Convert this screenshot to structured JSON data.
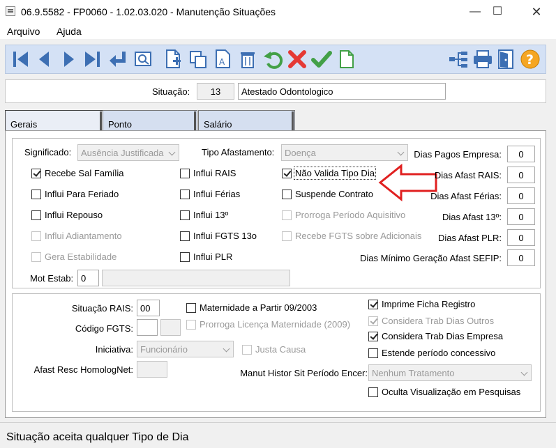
{
  "window": {
    "title": "06.9.5582 - FP0060 - 1.02.03.020 - Manutenção Situações",
    "minimize": "—",
    "maximize": "☐",
    "close": "✕"
  },
  "menu": {
    "items": [
      "Arquivo",
      "Ajuda"
    ]
  },
  "toolbar": {
    "icons": [
      "first-icon",
      "previous-icon",
      "next-icon",
      "last-icon",
      "return-icon",
      "zoom-icon",
      "new-icon",
      "copy-icon",
      "text-icon",
      "delete-icon",
      "undo-icon",
      "cancel-icon",
      "confirm-icon",
      "blank-page-icon",
      "tree-icon",
      "print-icon",
      "exit-icon",
      "help-icon"
    ],
    "help_glyph": "?"
  },
  "situacao": {
    "label": "Situação:",
    "code": "13",
    "description": "Atestado Odontologico"
  },
  "tabs": [
    "Gerais",
    "Ponto",
    "Salário"
  ],
  "gerais": {
    "significado": {
      "label": "Significado:",
      "value": "Ausência Justificada"
    },
    "tipo_afastamento": {
      "label": "Tipo Afastamento:",
      "value": "Doença"
    },
    "checkboxes": {
      "recebe_sal_familia": "Recebe Sal Família",
      "influi_feriado": "Influi Para Feriado",
      "influi_repouso": "Influi Repouso",
      "influi_adiantamento": "Influi Adiantamento",
      "gera_estabilidade": "Gera Estabilidade",
      "influi_rais": "Influi RAIS",
      "influi_ferias": "Influi Férias",
      "influi_13": "Influi 13º",
      "influi_fgts_13": "Influi FGTS 13o",
      "influi_plr": "Influi PLR",
      "nao_valida_tipo_dia": "Não Valida Tipo Dia",
      "suspende_contrato": "Suspende Contrato",
      "prorroga_periodo": "Prorroga Período Aquisitivo",
      "recebe_fgts_adicionais": "Recebe FGTS sobre Adicionais"
    },
    "dias": [
      {
        "label": "Dias Pagos Empresa:",
        "value": "0"
      },
      {
        "label": "Dias Afast RAIS:",
        "value": "0"
      },
      {
        "label": "Dias Afast Férias:",
        "value": "0"
      },
      {
        "label": "Dias Afast 13º:",
        "value": "0"
      },
      {
        "label": "Dias Afast PLR:",
        "value": "0"
      },
      {
        "label": "Dias Mínimo Geração Afast SEFIP:",
        "value": "0"
      }
    ],
    "mot_estab": {
      "label": "Mot Estab:",
      "value": "0",
      "description": ""
    }
  },
  "lower": {
    "situacao_rais": {
      "label": "Situação RAIS:",
      "value": "00"
    },
    "codigo_fgts": {
      "label": "Código FGTS:",
      "value": ""
    },
    "iniciativa": {
      "label": "Iniciativa:",
      "value": "Funcionário"
    },
    "afast_resc": {
      "label": "Afast Resc HomologNet:",
      "value": ""
    },
    "maternidade": "Maternidade a Partir 09/2003",
    "prorroga_licenca": "Prorroga Licença Maternidade (2009)",
    "justa_causa": "Justa Causa",
    "manut_histor": {
      "label": "Manut Histor Sit Período Encer:",
      "value": "Nenhum Tratamento"
    },
    "imprime_ficha": "Imprime Ficha Registro",
    "considera_outros": "Considera Trab Dias Outros",
    "considera_empresa": "Considera Trab Dias Empresa",
    "estende_periodo": "Estende período concessivo",
    "oculta_visualizacao": "Oculta Visualização em Pesquisas"
  },
  "status": {
    "text": "Situação aceita qualquer Tipo de Dia"
  },
  "colors": {
    "toolbar_bg": "#d4e1f5",
    "icon_blue": "#3d6fb3",
    "cancel_red": "#e53935",
    "confirm_green": "#43a047",
    "help_orange": "#f5a623",
    "arrow_red": "#e02020"
  }
}
